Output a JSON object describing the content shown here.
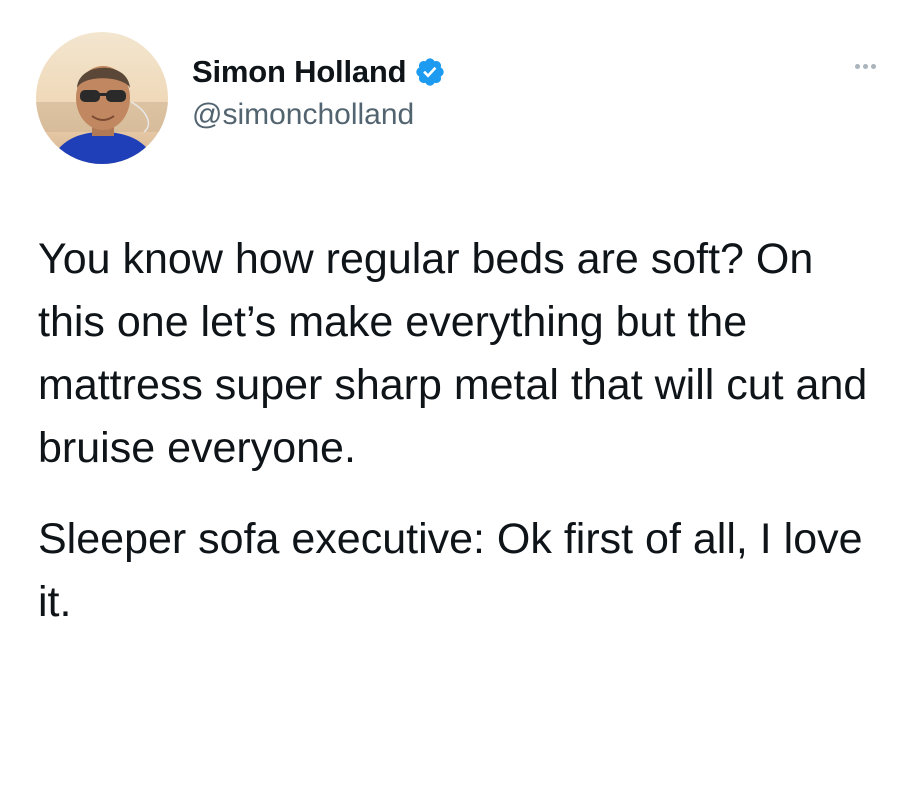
{
  "tweet": {
    "author": {
      "display_name": "Simon Holland",
      "handle": "@simoncholland",
      "verified": true,
      "avatar_icon": "profile-photo"
    },
    "more_icon": "ellipsis-icon",
    "paragraphs": [
      "You know how regular beds are soft? On this one let’s make everything but the mattress super sharp metal that will cut and bruise everyone.",
      "Sleeper sofa executive: Ok first of all, I love it."
    ]
  },
  "colors": {
    "text": "#0f1419",
    "secondary_text": "#536471",
    "verified_badge": "#1d9bf0",
    "background": "#ffffff"
  }
}
